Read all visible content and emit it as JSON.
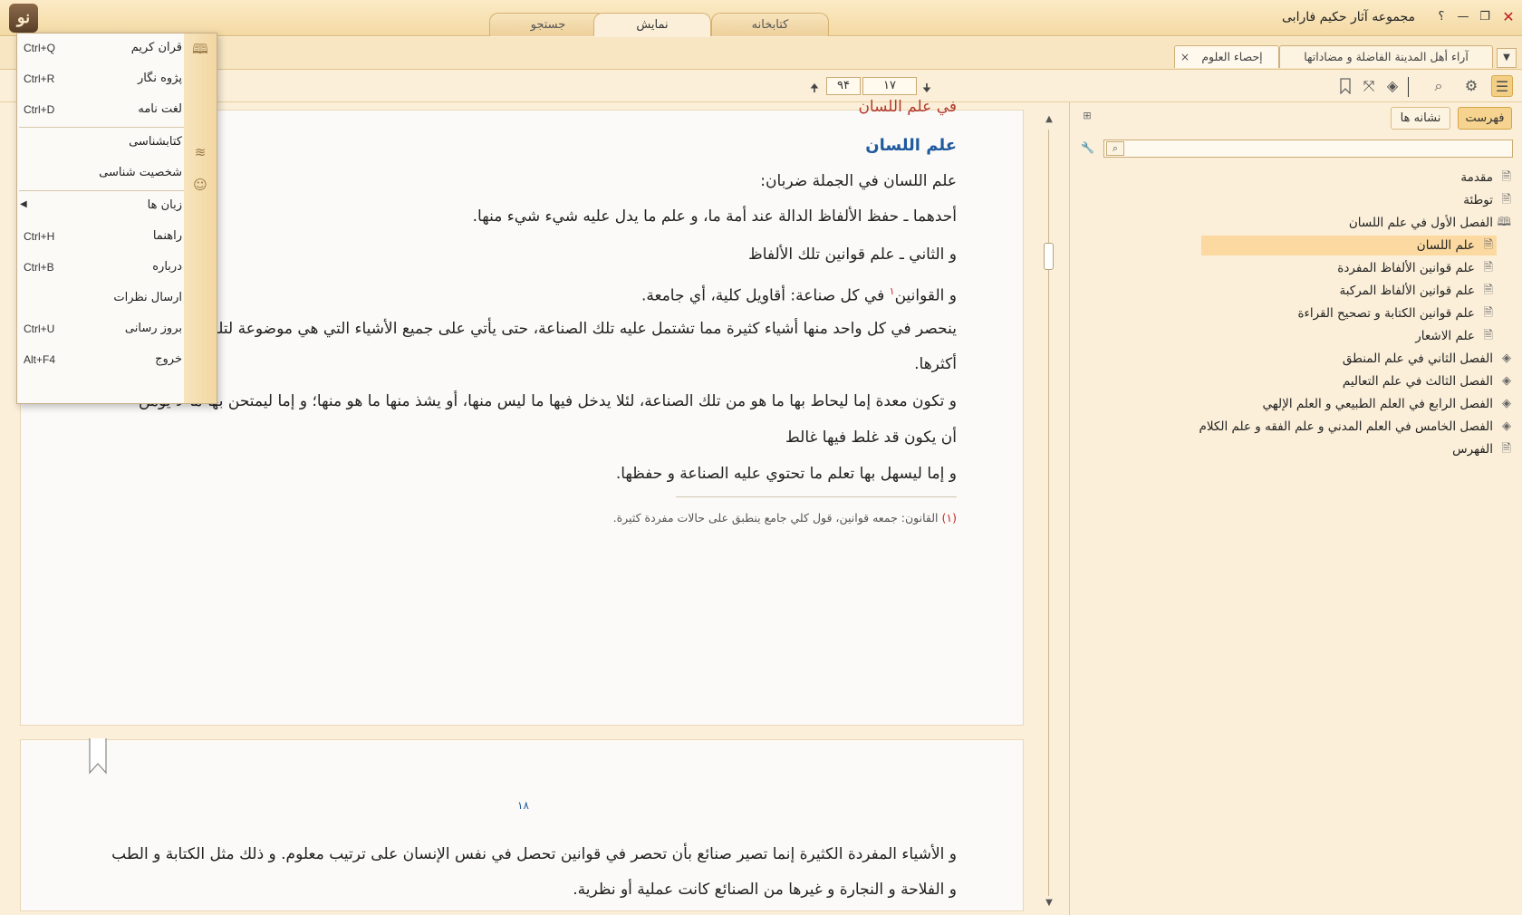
{
  "window": {
    "title": "مجموعه آثار حکیم فارابی",
    "logo": "نو",
    "buttons": {
      "close": "✕",
      "maximize": "❐",
      "minimize": "—",
      "help": "؟"
    }
  },
  "top_tabs": [
    {
      "label": "کتابخانه",
      "active": false
    },
    {
      "label": "نمایش",
      "active": true
    },
    {
      "label": "جستجو",
      "active": false
    }
  ],
  "doc_tabs": [
    {
      "label": "آراء أهل المدينة الفاضلة و مضاداتها",
      "active": false
    },
    {
      "label": "إحصاء العلوم",
      "active": true,
      "close": "×"
    }
  ],
  "page_nav": {
    "current": "۱۷",
    "total": "۹۴"
  },
  "content": {
    "heading_cut": "في علم اللسان",
    "heading": "علم اللسان",
    "paragraphs": [
      "علم اللسان في الجملة ضربان:",
      "أحدهما ـ حفظ الألفاظ الدالة عند أمة ما، و علم ما يدل عليه شيء شيء منها.",
      "و الثاني ـ علم قوانين تلك الألفاظ",
      "في كل صناعة: أقاويل كلية، أي جامعة.",
      "ينحصر في كل واحد منها أشياء كثيرة مما تشتمل عليه تلك الصناعة، حتى يأتي على جميع الأشياء التي هي موضوعة لتلك الصناعة أو على",
      "أكثرها.",
      "و تكون معدة إما ليحاط بها ما هو من تلك الصناعة، لئلا يدخل فيها ما ليس منها، أو يشذ منها ما هو منها؛ و إما ليمتحن بها ما لا يؤمن",
      "أن يكون قد غلط فيها غالط",
      "و إما ليسهل بها تعلم ما تحتوي عليه الصناعة و حفظها."
    ],
    "qawanin_prefix": "و القوانين",
    "footnote_marker": "۱",
    "footnote_num": "(۱)",
    "footnote_text": "القانون: جمعه قوانين، قول كلي جامع ينطبق على حالات مفردة كثيرة.",
    "page2_number": "۱۸",
    "page2_paragraphs": [
      "و الأشياء المفردة الكثيرة إنما تصير صنائع بأن تحصر في قوانين تحصل في نفس الإنسان على ترتيب معلوم. و ذلك مثل الكتابة و الطب",
      "و الفلاحة و النجارة و غيرها من الصنائع كانت عملية أو نظرية."
    ]
  },
  "right_panel": {
    "tabs": [
      {
        "label": "فهرست",
        "active": true
      },
      {
        "label": "نشانه ها",
        "active": false
      }
    ],
    "search_placeholder": "",
    "toc": [
      {
        "label": "مقدمة",
        "icon": "page-icon",
        "level": 0
      },
      {
        "label": "توطئة",
        "icon": "page-icon",
        "level": 0
      },
      {
        "label": "الفصل الأول في علم اللسان",
        "icon": "open-book-icon",
        "level": 0
      },
      {
        "label": "علم اللسان",
        "icon": "page-icon",
        "level": 1,
        "selected": true
      },
      {
        "label": "علم قوانين الألفاظ المفردة",
        "icon": "page-icon",
        "level": 1
      },
      {
        "label": "علم قوانين الألفاظ المركبة",
        "icon": "page-icon",
        "level": 1
      },
      {
        "label": "علم قوانين الكتابة و تصحيح القراءة",
        "icon": "page-icon",
        "level": 1
      },
      {
        "label": "علم الاشعار",
        "icon": "page-icon",
        "level": 1
      },
      {
        "label": "الفصل الثاني في علم المنطق",
        "icon": "closed-book-icon",
        "level": 0
      },
      {
        "label": "الفصل الثالث في علم التعاليم",
        "icon": "closed-book-icon",
        "level": 0
      },
      {
        "label": "الفصل الرابع في العلم الطبيعي و العلم الإلهي",
        "icon": "closed-book-icon",
        "level": 0
      },
      {
        "label": "الفصل الخامس في العلم المدني و علم الفقه و علم الكلام",
        "icon": "closed-book-icon",
        "level": 0
      },
      {
        "label": "الفهرس",
        "icon": "page-icon",
        "level": 0
      }
    ]
  },
  "menu": {
    "items": [
      {
        "label": "قران کریم",
        "shortcut": "Ctrl+Q",
        "icon": "quran-icon"
      },
      {
        "label": "پژوه نگار",
        "shortcut": "Ctrl+R"
      },
      {
        "label": "لغت نامه",
        "shortcut": "Ctrl+D"
      },
      {
        "label": "کتابشناسی",
        "shortcut": "",
        "icon": "books-icon"
      },
      {
        "label": "شخصیت شناسی",
        "shortcut": "",
        "icon": "person-icon"
      },
      {
        "label": "زبان ها",
        "shortcut": "",
        "submenu": true
      },
      {
        "label": "راهنما",
        "shortcut": "Ctrl+H"
      },
      {
        "label": "درباره",
        "shortcut": "Ctrl+B"
      },
      {
        "label": "ارسال نظرات",
        "shortcut": ""
      },
      {
        "label": "بروز رسانی",
        "shortcut": "Ctrl+U"
      },
      {
        "label": "خروج",
        "shortcut": "Alt+F4"
      }
    ]
  }
}
